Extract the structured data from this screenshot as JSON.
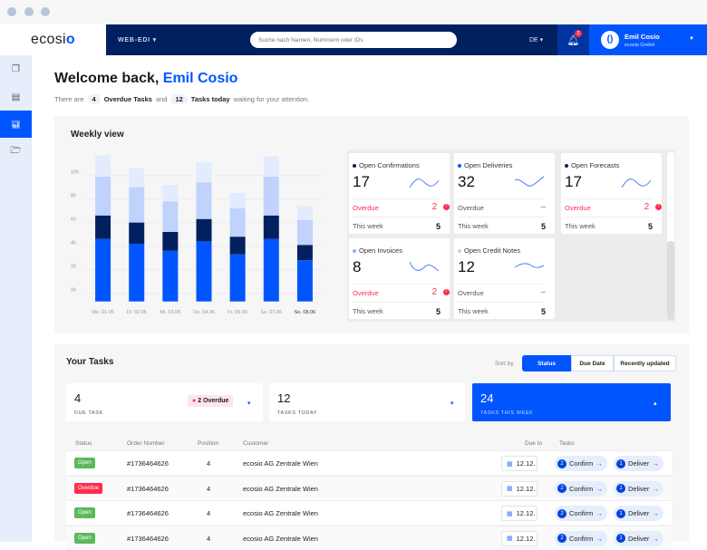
{
  "window": {
    "dots": 3
  },
  "header": {
    "logo": "ecosi",
    "logo_accent": "o",
    "module": "WEB-EDI ▾",
    "search_placeholder": "Suche nach Namen, Nummern oder IDs",
    "lang": "DE ▾",
    "notifications": "2",
    "user_name": "Emil Cosio",
    "user_company": "ecosio GmbH"
  },
  "sidebar": {
    "items": [
      {
        "icon": "documents-icon"
      },
      {
        "icon": "list-icon"
      },
      {
        "icon": "chart-icon",
        "active": true
      },
      {
        "icon": "folder-icon"
      }
    ]
  },
  "welcome": {
    "prefix": "Welcome back, ",
    "name": "Emil Cosio",
    "s1": "There are",
    "overdue_count": "4",
    "overdue_label": "Overdue Tasks",
    "s2": "and",
    "today_count": "12",
    "today_label": "Tasks today",
    "s3": "waiting for your attention."
  },
  "weekly": {
    "title": "Weekly view"
  },
  "chart_data": {
    "type": "bar",
    "stacked": true,
    "categories": [
      "Mo. 01.06",
      "Di. 02.06",
      "Mi. 03.06",
      "Do. 04.06",
      "Fr. 05.06",
      "Sa. 07.06",
      "So. 08.06"
    ],
    "yticks": [
      "0h",
      "2h",
      "4h",
      "6h",
      "8h",
      "10h"
    ],
    "ylim": [
      -1,
      11.5
    ],
    "grid": true,
    "colors": [
      "#0055ff",
      "#002060",
      "#bfd3fd",
      "#e3ebfe"
    ],
    "series": [
      {
        "values": [
          5.3,
          4.9,
          4.3,
          5.1,
          4.0,
          5.3,
          3.5
        ]
      },
      {
        "values": [
          2.0,
          1.8,
          1.6,
          1.9,
          1.5,
          2.0,
          1.3
        ]
      },
      {
        "values": [
          3.3,
          3.0,
          2.6,
          3.1,
          2.4,
          3.3,
          2.1
        ]
      },
      {
        "values": [
          1.8,
          1.6,
          1.4,
          1.7,
          1.3,
          1.7,
          1.2
        ]
      }
    ]
  },
  "cards": [
    {
      "title": "Open Confirmations",
      "dot": "#002060",
      "value": "17",
      "overdue_label": "Overdue",
      "overdue": "2",
      "overdue_alert": true,
      "week_label": "This week",
      "week": "5"
    },
    {
      "title": "Open Deliveries",
      "dot": "#0055ff",
      "value": "32",
      "overdue_label": "Overdue",
      "overdue": "–",
      "overdue_alert": false,
      "week_label": "This week",
      "week": "5"
    },
    {
      "title": "Open Forecasts",
      "dot": "#002060",
      "value": "17",
      "overdue_label": "Overdue",
      "overdue": "2",
      "overdue_alert": true,
      "week_label": "This week",
      "week": "5"
    },
    {
      "title": "Open Invoices",
      "dot": "#8fb0f8",
      "value": "8",
      "overdue_label": "Overdue",
      "overdue": "2",
      "overdue_alert": true,
      "week_label": "This week",
      "week": "5"
    },
    {
      "title": "Open Credit Notes",
      "dot": "#bfd3fd",
      "value": "12",
      "overdue_label": "Overdue",
      "overdue": "–",
      "overdue_alert": false,
      "week_label": "This week",
      "week": "5"
    }
  ],
  "tasks": {
    "title": "Your Tasks",
    "sort_label": "Sort by",
    "sort_options": [
      "Status",
      "Due Date",
      "Recently updated"
    ],
    "sort_selected": "Status",
    "summary": [
      {
        "value": "4",
        "label": "DUE TASK",
        "badge": "2 Overdue",
        "caret": "▾"
      },
      {
        "value": "12",
        "label": "TASKS TODAY",
        "caret": "▾"
      },
      {
        "value": "24",
        "label": "TASKS THIS WEEK",
        "caret": "▴",
        "active": true
      }
    ],
    "columns": [
      "Status",
      "Order Number",
      "Position",
      "Customer",
      "Due to",
      "Tasks"
    ],
    "rows": [
      {
        "status": "Open",
        "order": "#1736464626",
        "position": "4",
        "customer": "ecosio AG Zentrale Wien",
        "due": "12.12.",
        "confirm_n": "2",
        "confirm": "Confirm",
        "deliver_n": "1",
        "deliver": "Deliver"
      },
      {
        "status": "Overdue",
        "order": "#1736464626",
        "position": "4",
        "customer": "ecosio AG Zentrale Wien",
        "due": "12.12.",
        "confirm_n": "2",
        "confirm": "Confirm",
        "deliver_n": "1",
        "deliver": "Deliver"
      },
      {
        "status": "Open",
        "order": "#1736464626",
        "position": "4",
        "customer": "ecosio AG Zentrale Wien",
        "due": "12.12.",
        "confirm_n": "2",
        "confirm": "Confirm",
        "deliver_n": "1",
        "deliver": "Deliver"
      },
      {
        "status": "Open",
        "order": "#1736464626",
        "position": "4",
        "customer": "ecosio AG Zentrale Wien",
        "due": "12.12.",
        "confirm_n": "2",
        "confirm": "Confirm",
        "deliver_n": "1",
        "deliver": "Deliver"
      }
    ]
  },
  "colors": {
    "navy": "#002060",
    "accent": "#0055ff",
    "open": "#5cb85c",
    "overdue": "#ff2d4b"
  }
}
